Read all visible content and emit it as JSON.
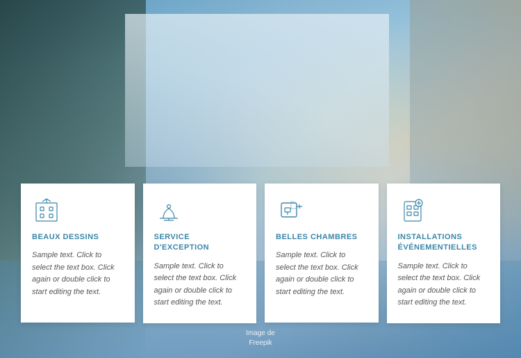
{
  "background": {
    "image_credit_line1": "Image de",
    "image_credit_line2": "Freepik"
  },
  "cards": [
    {
      "id": "card-1",
      "icon": "hotel-building",
      "title": "BEAUX DESSINS",
      "text": "Sample text. Click to select the text box. Click again or double click to start editing the text."
    },
    {
      "id": "card-2",
      "icon": "service-bell",
      "title": "SERVICE D'EXCEPTION",
      "text": "Sample text. Click to select the text box. Click again or double click to start editing the text."
    },
    {
      "id": "card-3",
      "icon": "room-key",
      "title": "BELLES CHAMBRES",
      "text": "Sample text. Click to select the text box. Click again or double click to start editing the text."
    },
    {
      "id": "card-4",
      "icon": "map-pin",
      "title": "INSTALLATIONS ÉVÉNEMENTIELLES",
      "text": "Sample text. Click to select the text box. Click again or double click to start editing the text."
    }
  ]
}
